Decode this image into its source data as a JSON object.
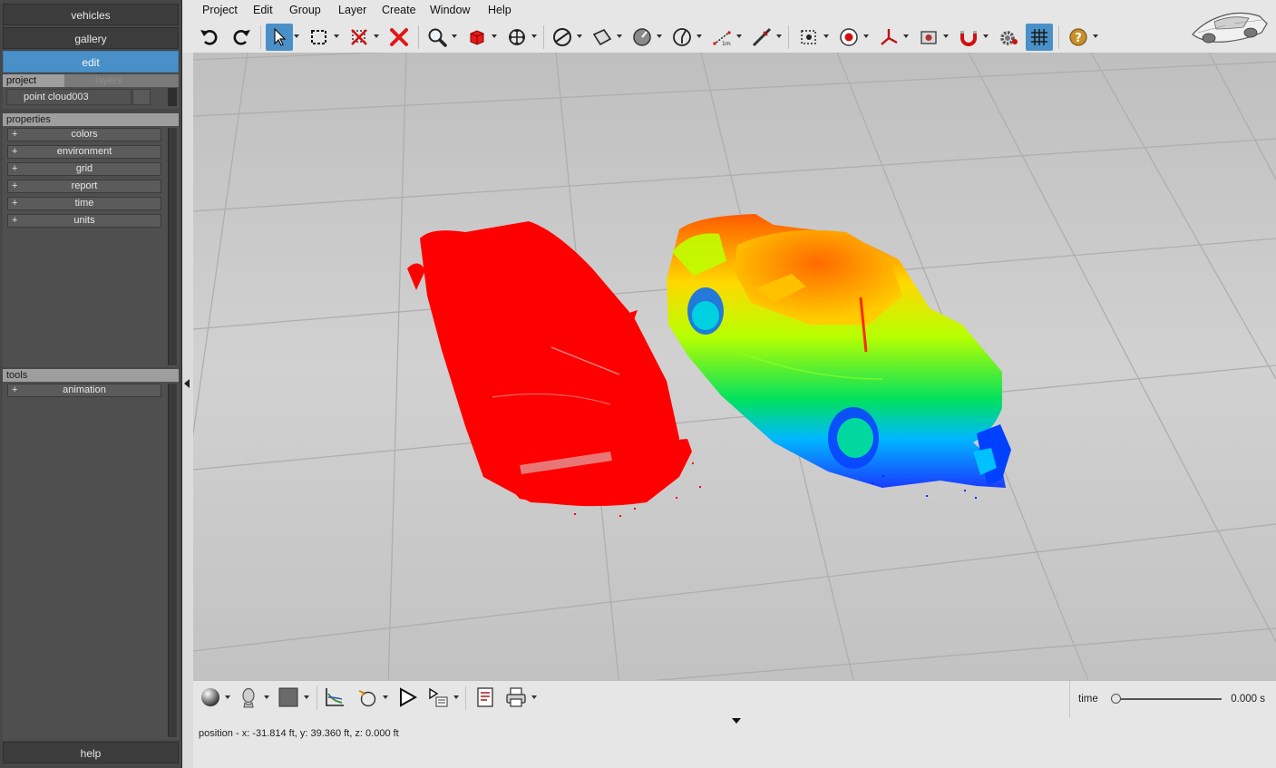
{
  "nav": {
    "vehicles": "vehicles",
    "gallery": "gallery",
    "edit": "edit",
    "help": "help"
  },
  "project_panel": {
    "tabs": {
      "project": "project",
      "layers": "layers"
    },
    "items": [
      "point cloud003"
    ]
  },
  "properties": {
    "title": "properties",
    "items": [
      "colors",
      "environment",
      "grid",
      "report",
      "time",
      "units"
    ],
    "expander": "+"
  },
  "tools": {
    "title": "tools",
    "items": [
      "animation"
    ]
  },
  "menu": [
    "Project",
    "Edit",
    "Group",
    "Layer",
    "Create",
    "Window",
    "Help"
  ],
  "toolbar_icons": [
    "undo-icon",
    "redo-icon",
    "select-arrow-icon",
    "marquee-icon",
    "hide-points-icon",
    "delete-icon",
    "zoom-icon",
    "cube-icon",
    "move-icon",
    "sphere-icon",
    "plane-icon",
    "gauge-icon",
    "measure-angle-icon",
    "distance-ruler-icon",
    "scale-icon",
    "camera-target-icon",
    "record-icon",
    "axis-icon",
    "snapshot-icon",
    "magnet-icon",
    "settings-gear-icon",
    "grid-toggle-icon",
    "help-icon"
  ],
  "colors": {
    "accent": "#4a90c8",
    "cloud_red": "#ff0000",
    "viewport_bg": "#c9c9c9"
  },
  "time": {
    "label": "time",
    "value": "0.000 s",
    "progress": 0
  },
  "status": {
    "position": "position - x: -31.814 ft, y: 39.360 ft, z: 0.000 ft"
  }
}
